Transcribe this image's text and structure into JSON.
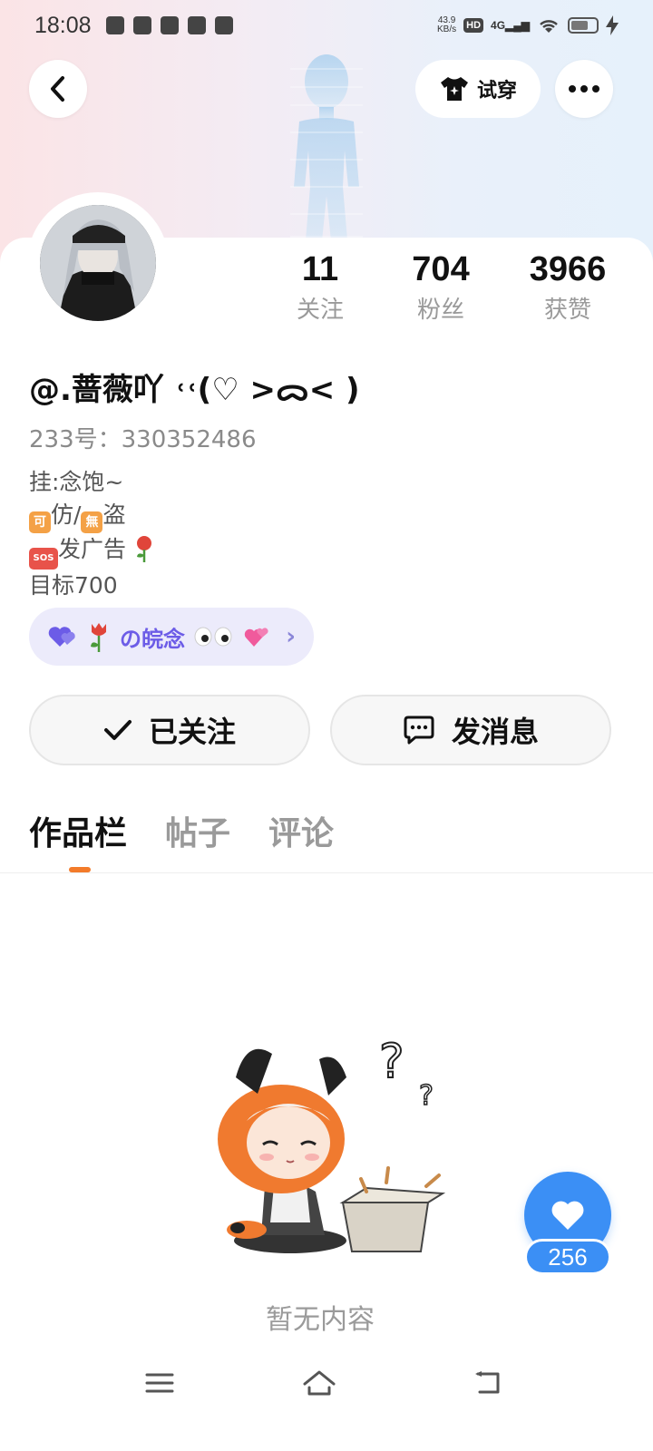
{
  "status_bar": {
    "time": "18:08",
    "net_speed_value": "43.9",
    "net_speed_unit": "KB/s",
    "hd_label": "HD",
    "signal_label": "4G"
  },
  "header": {
    "tryon_label": "试穿",
    "more_icon": "more-dots-icon",
    "back_icon": "chevron-left-icon"
  },
  "stats": [
    {
      "value": "11",
      "label": "关注"
    },
    {
      "value": "704",
      "label": "粉丝"
    },
    {
      "value": "3966",
      "label": "获赞"
    }
  ],
  "profile": {
    "username": "@.蔷薇吖 ˓˓(♡ >ᯅ< )",
    "uid": "233号：330352486",
    "bio_lines": [
      "挂:念饱~",
      "仿/",
      "盗",
      "发广告",
      "目标700"
    ],
    "bio_emoji": {
      "ke": "可",
      "wu": "無",
      "sos": "SOS"
    }
  },
  "fan_group": {
    "label": "の皖念",
    "suffix": "›"
  },
  "actions": {
    "follow_label": "已关注",
    "message_label": "发消息"
  },
  "tabs": [
    {
      "label": "作品栏",
      "active": true
    },
    {
      "label": "帖子",
      "active": false
    },
    {
      "label": "评论",
      "active": false
    }
  ],
  "empty": {
    "text": "暂无内容"
  },
  "like_fab": {
    "count": "256"
  },
  "colors": {
    "accent_orange": "#f37b2a",
    "fab_blue": "#3b8ff5",
    "fan_purple": "#6c5ce7"
  }
}
